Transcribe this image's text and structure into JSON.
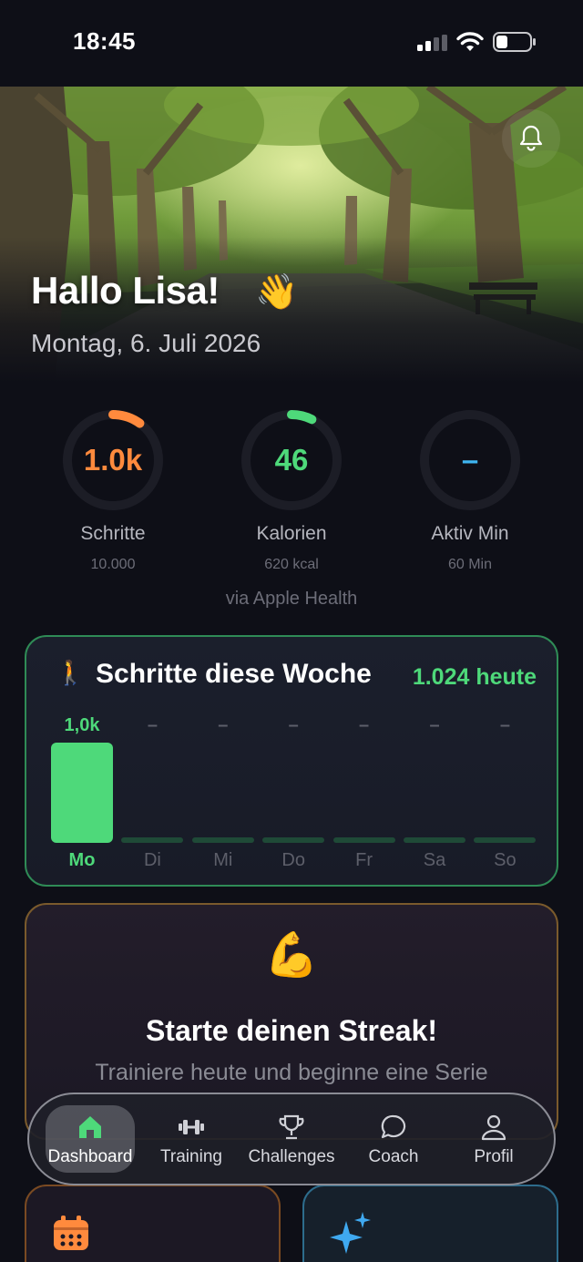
{
  "status_bar": {
    "time": "18:45"
  },
  "hero": {
    "greeting": "Hallo Lisa!",
    "wave_emoji": "👋",
    "date": "Montag, 6. Juli 2026"
  },
  "rings": [
    {
      "value": "1.0k",
      "label": "Schritte",
      "sub": "10.000",
      "progress": 0.1,
      "color": "#ff8a3d"
    },
    {
      "value": "46",
      "label": "Kalorien",
      "sub": "620 kcal",
      "progress": 0.074,
      "color": "#4ed97a"
    },
    {
      "value": "–",
      "label": "Aktiv Min",
      "sub": "60 Min",
      "progress": 0,
      "color": "#3fb5f0"
    }
  ],
  "via_text": "via Apple Health",
  "steps_week": {
    "icon": "🚶",
    "title": "Schritte diese Woche",
    "today": "1.024 heute",
    "days": [
      {
        "day": "Mo",
        "label": "1,0k",
        "steps": 1024,
        "active": true
      },
      {
        "day": "Di",
        "label": "–",
        "steps": 0,
        "active": false
      },
      {
        "day": "Mi",
        "label": "–",
        "steps": 0,
        "active": false
      },
      {
        "day": "Do",
        "label": "–",
        "steps": 0,
        "active": false
      },
      {
        "day": "Fr",
        "label": "–",
        "steps": 0,
        "active": false
      },
      {
        "day": "Sa",
        "label": "–",
        "steps": 0,
        "active": false
      },
      {
        "day": "So",
        "label": "–",
        "steps": 0,
        "active": false
      }
    ]
  },
  "streak": {
    "emoji": "💪",
    "title": "Starte deinen Streak!",
    "subtitle": "Trainiere heute und beginne eine Serie"
  },
  "tabs": [
    {
      "label": "Dashboard",
      "icon": "home-icon",
      "active": true
    },
    {
      "label": "Training",
      "icon": "dumbbell-icon",
      "active": false
    },
    {
      "label": "Challenges",
      "icon": "trophy-icon",
      "active": false
    },
    {
      "label": "Coach",
      "icon": "chat-bubble-icon",
      "active": false
    },
    {
      "label": "Profil",
      "icon": "person-icon",
      "active": false
    }
  ],
  "colors": {
    "accent_green": "#4ed97a",
    "accent_orange": "#ff8a3d",
    "accent_blue": "#3fb5f0",
    "background": "#0e0f17"
  }
}
